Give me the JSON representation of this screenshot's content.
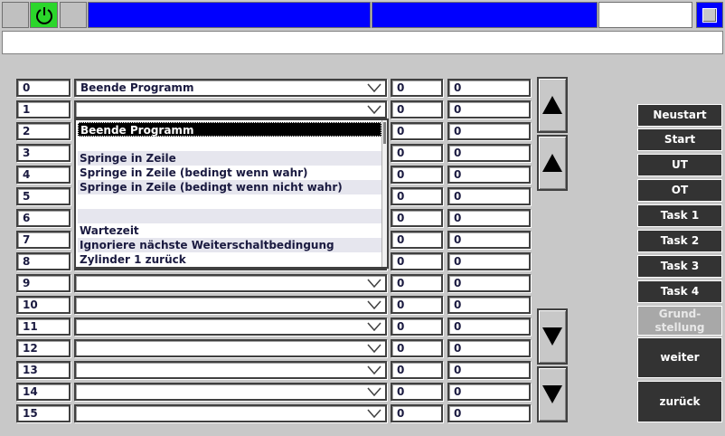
{
  "rows": [
    {
      "index": "0",
      "command": "Beende Programm",
      "a": "0",
      "b": "0"
    },
    {
      "index": "1",
      "command": "",
      "a": "0",
      "b": "0"
    },
    {
      "index": "2",
      "command": "",
      "a": "0",
      "b": "0"
    },
    {
      "index": "3",
      "command": "",
      "a": "0",
      "b": "0"
    },
    {
      "index": "4",
      "command": "",
      "a": "0",
      "b": "0"
    },
    {
      "index": "5",
      "command": "",
      "a": "0",
      "b": "0"
    },
    {
      "index": "6",
      "command": "",
      "a": "0",
      "b": "0"
    },
    {
      "index": "7",
      "command": "",
      "a": "0",
      "b": "0"
    },
    {
      "index": "8",
      "command": "",
      "a": "0",
      "b": "0"
    },
    {
      "index": "9",
      "command": "",
      "a": "0",
      "b": "0"
    },
    {
      "index": "10",
      "command": "",
      "a": "0",
      "b": "0"
    },
    {
      "index": "11",
      "command": "",
      "a": "0",
      "b": "0"
    },
    {
      "index": "12",
      "command": "",
      "a": "0",
      "b": "0"
    },
    {
      "index": "13",
      "command": "",
      "a": "0",
      "b": "0"
    },
    {
      "index": "14",
      "command": "",
      "a": "0",
      "b": "0"
    },
    {
      "index": "15",
      "command": "",
      "a": "0",
      "b": "0"
    }
  ],
  "dropdown": {
    "options": [
      "Beende Programm",
      "",
      "Springe in Zeile",
      "Springe in Zeile (bedingt wenn wahr)",
      "Springe in Zeile (bedingt wenn nicht wahr)",
      "",
      "",
      "Wartezeit",
      "Ignoriere nächste Weiterschaltbedingung",
      "Zylinder 1 zurück"
    ],
    "selected": "Beende Programm"
  },
  "buttons": {
    "neustart": "Neustart",
    "start": "Start",
    "ut": "UT",
    "ot": "OT",
    "task1": "Task 1",
    "task2": "Task 2",
    "task3": "Task 3",
    "task4": "Task 4",
    "grundstellung": "Grund-\nstellung",
    "weiter": "weiter",
    "zurueck": "zurück"
  },
  "colors": {
    "power": "#2bd62b",
    "header_blue": "#0000ff",
    "button_dark": "#333333",
    "button_disabled": "#a8a8a8"
  },
  "icons": {
    "power": "power-icon",
    "scroll_page_up": "scroll-page-up-icon",
    "scroll_up": "scroll-up-icon",
    "scroll_down": "scroll-down-icon",
    "scroll_page_down": "scroll-page-down-icon"
  }
}
